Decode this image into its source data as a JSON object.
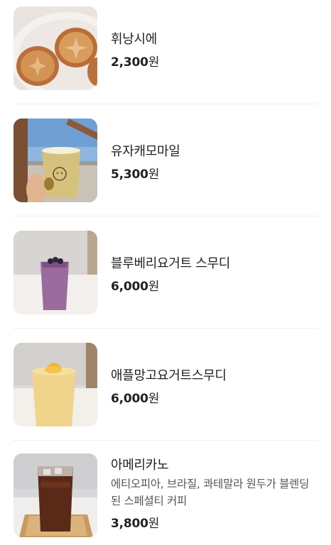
{
  "menu": {
    "items": [
      {
        "name": "휘낭시에",
        "price": "2,300",
        "unit": "원",
        "image": "financier-photo"
      },
      {
        "name": "유자캐모마일",
        "price": "5,300",
        "unit": "원",
        "image": "yuzu-chamomile-photo"
      },
      {
        "name": "블루베리요거트 스무디",
        "price": "6,000",
        "unit": "원",
        "image": "blueberry-smoothie-photo"
      },
      {
        "name": "애플망고요거트스무디",
        "price": "6,000",
        "unit": "원",
        "image": "mango-smoothie-photo"
      },
      {
        "name": "아메리카노",
        "desc": "에티오피아, 브라질, 콰테말라 원두가 블렌딩된 스페셜티 커피",
        "price": "3,800",
        "unit": "원",
        "image": "americano-photo"
      }
    ]
  }
}
